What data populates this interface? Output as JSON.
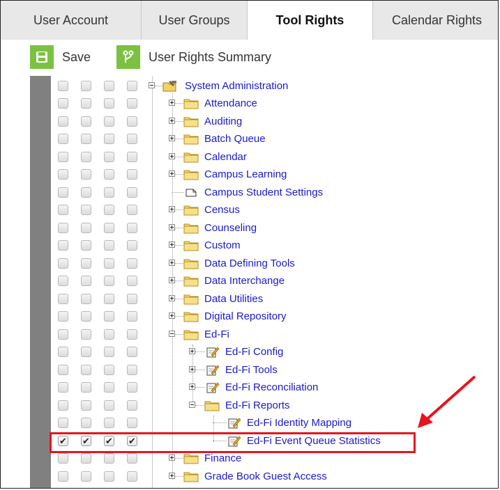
{
  "tabs": [
    {
      "label": "User Account",
      "active": false
    },
    {
      "label": "User Groups",
      "active": false
    },
    {
      "label": "Tool Rights",
      "active": true
    },
    {
      "label": "Calendar Rights",
      "active": false
    }
  ],
  "toolbar": {
    "save_label": "Save",
    "summary_label": "User Rights Summary"
  },
  "tree": {
    "root_label": "System Administration",
    "items": [
      {
        "label": "Attendance"
      },
      {
        "label": "Auditing"
      },
      {
        "label": "Batch Queue"
      },
      {
        "label": "Calendar"
      },
      {
        "label": "Campus Learning"
      },
      {
        "label": "Campus Student Settings"
      },
      {
        "label": "Census"
      },
      {
        "label": "Counseling"
      },
      {
        "label": "Custom"
      },
      {
        "label": "Data Defining Tools"
      },
      {
        "label": "Data Interchange"
      },
      {
        "label": "Data Utilities"
      },
      {
        "label": "Digital Repository"
      },
      {
        "label": "Ed-Fi"
      },
      {
        "label": "Ed-Fi Config"
      },
      {
        "label": "Ed-Fi Tools"
      },
      {
        "label": "Ed-Fi Reconciliation"
      },
      {
        "label": "Ed-Fi Reports"
      },
      {
        "label": "Ed-Fi Identity Mapping"
      },
      {
        "label": "Ed-Fi Event Queue Statistics"
      },
      {
        "label": "Finance"
      },
      {
        "label": "Grade Book Guest Access"
      }
    ]
  },
  "colors": {
    "link": "#1a1acc",
    "accent_green": "#7cc242",
    "highlight_red": "#e8141e"
  }
}
